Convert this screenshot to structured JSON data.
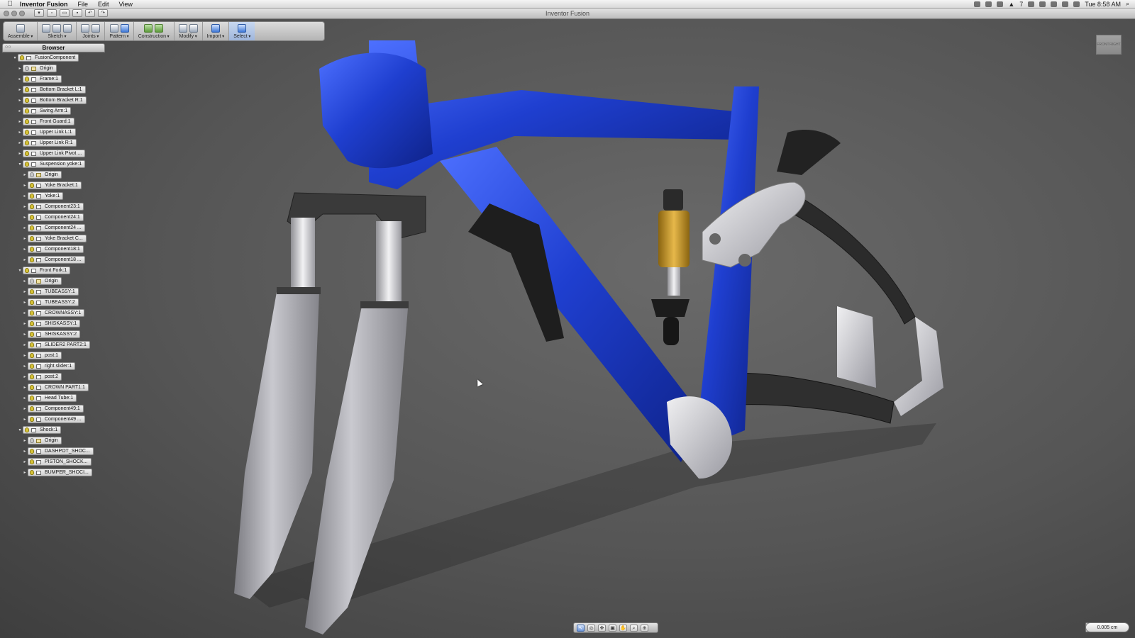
{
  "menubar": {
    "app_name": "Inventor Fusion",
    "menus": [
      "File",
      "Edit",
      "View"
    ],
    "status_count": "7",
    "clock": "Tue 8:58 AM"
  },
  "window": {
    "title": "Inventor Fusion"
  },
  "ribbon": {
    "groups": [
      {
        "label": "Assemble"
      },
      {
        "label": "Sketch"
      },
      {
        "label": "Joints"
      },
      {
        "label": "Pattern"
      },
      {
        "label": "Construction"
      },
      {
        "label": "Modify"
      },
      {
        "label": "Import"
      },
      {
        "label": "Select"
      }
    ]
  },
  "browser": {
    "title": "Browser",
    "items": [
      {
        "label": "FusionComponent",
        "depth": 0,
        "expanded": true
      },
      {
        "label": "Origin",
        "depth": 1
      },
      {
        "label": "Frame:1",
        "depth": 1
      },
      {
        "label": "Bottom Bracket L:1",
        "depth": 1
      },
      {
        "label": "Bottom Bracket R:1",
        "depth": 1
      },
      {
        "label": "Swing Arm:1",
        "depth": 1
      },
      {
        "label": "Front Guard:1",
        "depth": 1
      },
      {
        "label": "Upper Link L:1",
        "depth": 1
      },
      {
        "label": "Upper Link R:1",
        "depth": 1
      },
      {
        "label": "Upper Link Pivot ...",
        "depth": 1
      },
      {
        "label": "Suspension yoke:1",
        "depth": 1,
        "expanded": true
      },
      {
        "label": "Origin",
        "depth": 2
      },
      {
        "label": "Yoke Bracket:1",
        "depth": 2
      },
      {
        "label": "Yoke:1",
        "depth": 2
      },
      {
        "label": "Component23:1",
        "depth": 2
      },
      {
        "label": "Component24:1",
        "depth": 2
      },
      {
        "label": "Component24 ...",
        "depth": 2
      },
      {
        "label": "Yoke Bracket C...",
        "depth": 2
      },
      {
        "label": "Component18:1",
        "depth": 2
      },
      {
        "label": "Component18 ...",
        "depth": 2
      },
      {
        "label": "Front Fork:1",
        "depth": 1,
        "expanded": true
      },
      {
        "label": "Origin",
        "depth": 2
      },
      {
        "label": "TUBEASSY:1",
        "depth": 2
      },
      {
        "label": "TUBEASSY:2",
        "depth": 2
      },
      {
        "label": "CROWNASSY:1",
        "depth": 2
      },
      {
        "label": "SHISKASSY:1",
        "depth": 2
      },
      {
        "label": "SHISKASSY:2",
        "depth": 2
      },
      {
        "label": "SLIDER2 PART2:1",
        "depth": 2
      },
      {
        "label": "post:1",
        "depth": 2
      },
      {
        "label": "right slider:1",
        "depth": 2
      },
      {
        "label": "post:2",
        "depth": 2
      },
      {
        "label": "CROWN PART1:1",
        "depth": 2
      },
      {
        "label": "Head Tube:1",
        "depth": 2
      },
      {
        "label": "Component49:1",
        "depth": 2
      },
      {
        "label": "Component49 ...",
        "depth": 2
      },
      {
        "label": "Shock:1",
        "depth": 1,
        "expanded": true
      },
      {
        "label": "Origin",
        "depth": 2
      },
      {
        "label": "DASHPOT_SHOC...",
        "depth": 2
      },
      {
        "label": "PISTON_SHOCK...",
        "depth": 2
      },
      {
        "label": "BUMPER_SHOCI...",
        "depth": 2
      }
    ]
  },
  "viewcube": {
    "faces": [
      "FRONT",
      "RIGHT"
    ]
  },
  "status": {
    "unit_value": "0.005 cm"
  },
  "colors": {
    "frame_blue": "#1f3fd0",
    "shock_gold": "#c89a2a",
    "fork_gray": "#a8a8ae",
    "carbon": "#2b2b2b"
  }
}
